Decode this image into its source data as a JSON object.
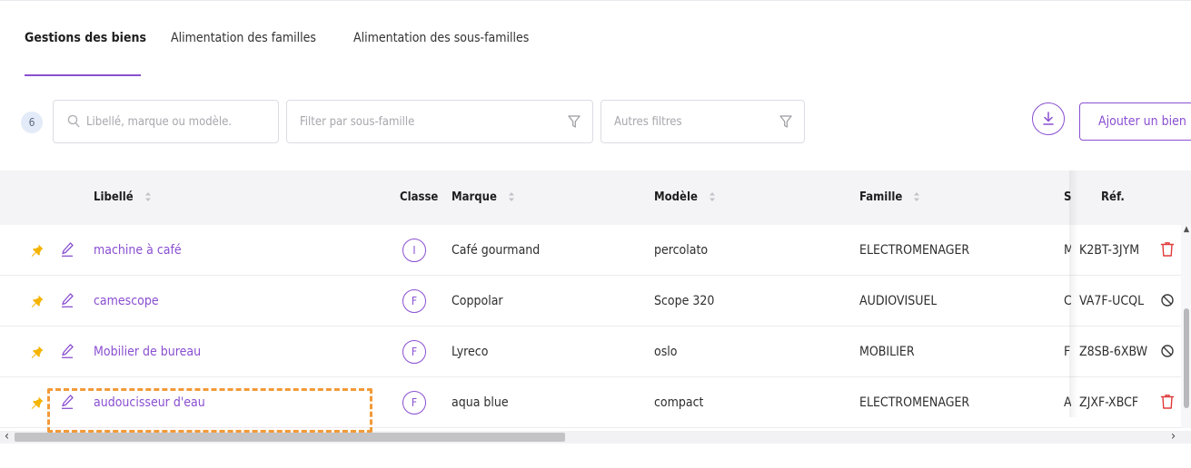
{
  "tabs": [
    {
      "label": "Gestions des biens",
      "active": true
    },
    {
      "label": "Alimentation des familles",
      "active": false
    },
    {
      "label": "Alimentation des sous-familles",
      "active": false
    }
  ],
  "toolbar": {
    "count": "6",
    "search_placeholder": "Libellé, marque ou modèle.",
    "filter_placeholder": "Filter par sous-famille",
    "others_placeholder": "Autres filtres",
    "add_label": "Ajouter un bien"
  },
  "columns": {
    "libelle": "Libellé",
    "classe": "Classe",
    "marque": "Marque",
    "modele": "Modèle",
    "famille": "Famille",
    "partial": "S",
    "ref": "Réf."
  },
  "rows": [
    {
      "libelle": "machine à café",
      "classe": "I",
      "marque": "Café gourmand",
      "modele": "percolato",
      "famille": "ELECTROMENAGER",
      "partial": "M",
      "ref": "K2BT-3JYM",
      "action": "trash-icon"
    },
    {
      "libelle": "camescope",
      "classe": "F",
      "marque": "Coppolar",
      "modele": "Scope 320",
      "famille": "AUDIOVISUEL",
      "partial": "C",
      "ref": "VA7F-UCQL",
      "action": "block-icon"
    },
    {
      "libelle": "Mobilier de bureau",
      "classe": "F",
      "marque": "Lyreco",
      "modele": "oslo",
      "famille": "MOBILIER",
      "partial": "F",
      "ref": "Z8SB-6XBW",
      "action": "block-icon"
    },
    {
      "libelle": "audoucisseur d'eau",
      "classe": "F",
      "marque": "aqua blue",
      "modele": "compact",
      "famille": "ELECTROMENAGER",
      "partial": "A",
      "ref": "ZJXF-XBCF",
      "action": "trash-icon"
    }
  ],
  "colors": {
    "accent": "#8a4fd1",
    "pin": "#f4b400",
    "danger": "#e03a3a",
    "highlight": "#f29a38"
  }
}
